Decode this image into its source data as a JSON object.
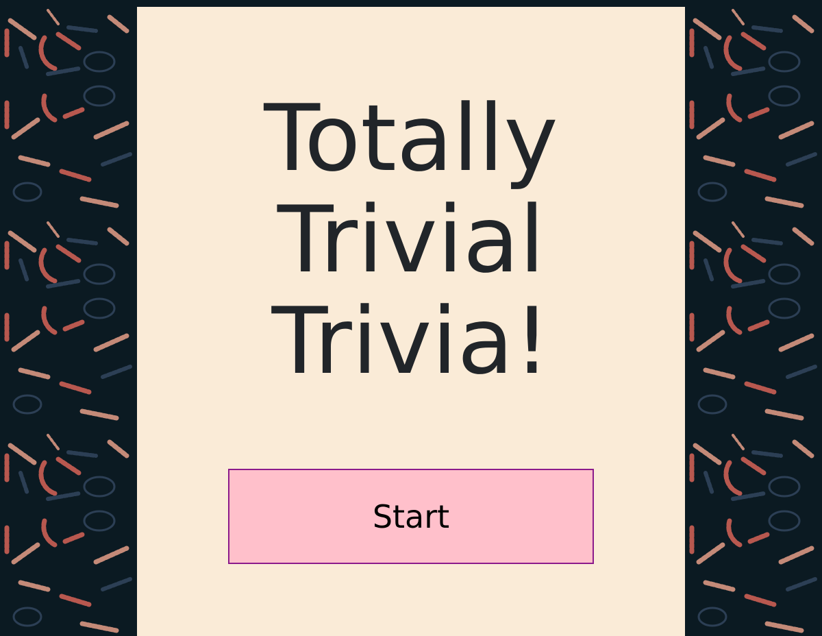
{
  "title_lines": [
    "Totally",
    "Trivial",
    "Trivia!"
  ],
  "start_button": {
    "label": "Start"
  },
  "colors": {
    "background": "#0b1a22",
    "panel": "#faebd7",
    "button_fill": "#ffc0cb",
    "button_border": "#8b1a8b",
    "pattern_red": "#b8584f",
    "pattern_tan": "#c48a78",
    "pattern_blue": "#2c3f55"
  },
  "background_pattern": "wheat-and-hops-icons"
}
